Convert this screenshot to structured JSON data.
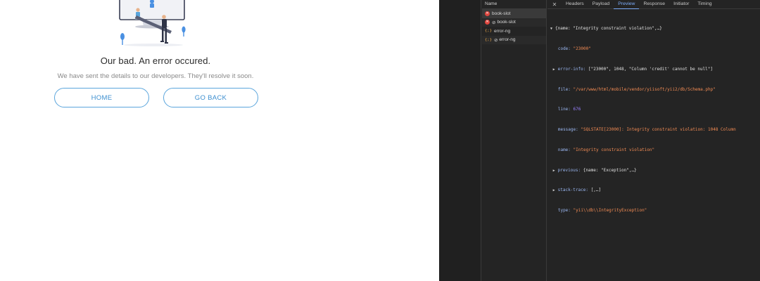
{
  "webpage": {
    "title": "Our bad. An error occured.",
    "subtitle": "We have sent the details to our developers. They'll resolve it soon.",
    "home_label": "HOME",
    "back_label": "GO BACK"
  },
  "devtools": {
    "name_header": "Name",
    "requests": [
      {
        "name": "book-slot",
        "status": "error"
      },
      {
        "name": "book-slot",
        "status": "error"
      },
      {
        "name": "error-ng",
        "status": "xhr"
      },
      {
        "name": "error-ng",
        "status": "xhr"
      }
    ],
    "request_prefix_icon": "⊘",
    "tabs": [
      "Headers",
      "Payload",
      "Preview",
      "Response",
      "Initiator",
      "Timing"
    ],
    "active_tab": "Preview",
    "preview": {
      "root": "{name: \"Integrity constraint violation\",…}",
      "code_key": "code:",
      "code_val": "\"23000\"",
      "errorinfo_key": "error-info:",
      "errorinfo_val": "[\"23000\", 1048, \"Column 'credit' cannot be null\"]",
      "file_key": "file:",
      "file_val": "\"/var/www/html/mobile/vendor/yiisoft/yii2/db/Schema.php\"",
      "line_key": "line:",
      "line_val": "676",
      "message_key": "message:",
      "message_val": "\"SQLSTATE[23000]: Integrity constraint violation: 1048 Column",
      "name_key": "name:",
      "name_val": "\"Integrity constraint violation\"",
      "previous_key": "previous:",
      "previous_val": "{name: \"Exception\",…}",
      "stack_key": "stack-trace:",
      "stack_val": "[,…]",
      "type_key": "type:",
      "type_val": "\"yii\\\\db\\\\IntegrityException\""
    }
  },
  "colors": {
    "accent": "#3d8fd0",
    "devtools_bg": "#242424",
    "error_red": "#e0463e"
  }
}
